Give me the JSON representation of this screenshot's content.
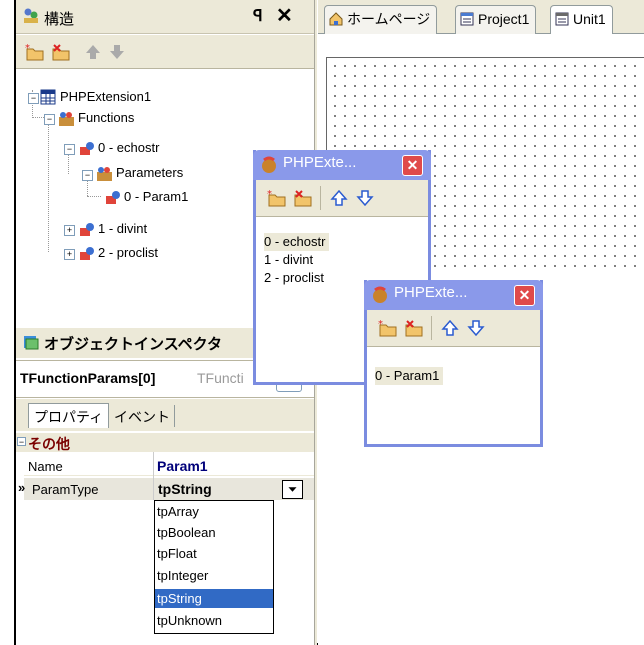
{
  "structure_panel": {
    "title": "構造",
    "pin_glyph": "ꟼ",
    "close_glyph": "✕",
    "toolbar": [
      "add-item-icon",
      "remove-item-icon",
      "move-up-icon",
      "move-down-icon"
    ],
    "tree": {
      "root": "PHPExtension1",
      "functions": "Functions",
      "func0": "0 - echostr",
      "parameters": "Parameters",
      "param0": "0 - Param1",
      "func1": "1 - divint",
      "func2": "2 - proclist"
    }
  },
  "object_inspector": {
    "title": "オブジェクトインスペクタ",
    "object_name": "TFunctionParams[0]",
    "object_type": "TFuncti",
    "tabs": {
      "properties": "プロパティ",
      "events": "イベント"
    },
    "group": "その他",
    "properties": [
      {
        "name": "Name",
        "value": "Param1"
      },
      {
        "name": "ParamType",
        "value": "tpString"
      }
    ],
    "current_marker": "»",
    "dropdown_options": [
      "tpArray",
      "tpBoolean",
      "tpFloat",
      "tpInteger",
      "tpString",
      "tpUnknown"
    ],
    "dropdown_selected": "tpString"
  },
  "editor_tabs": [
    "ホームページ",
    "Project1",
    "Unit1"
  ],
  "windows": [
    {
      "title": "PHPExte...",
      "items": [
        "0 - echostr",
        "1 - divint",
        "2 - proclist"
      ]
    },
    {
      "title": "PHPExte...",
      "items": [
        "0 - Param1"
      ]
    }
  ],
  "colors": {
    "panel_bg": "#ece9d8",
    "selection": "#316ac5",
    "window_title": "#8a99ea",
    "group_label": "#7a0000",
    "value_text": "#00007a"
  }
}
